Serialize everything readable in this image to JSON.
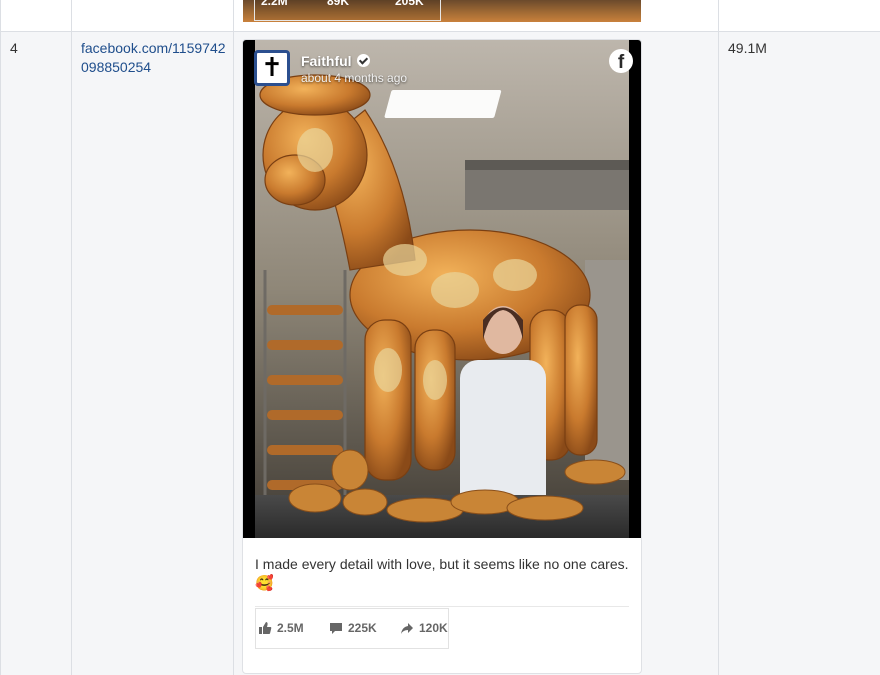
{
  "previous_row": {
    "stats": {
      "likes": "2.2M",
      "comments": "89K",
      "shares": "205K"
    }
  },
  "row": {
    "rank": "4",
    "url": "facebook.com/1159742098850254",
    "views": "49.1M",
    "post": {
      "page_name": "Faithful",
      "avatar_glyph": "✝",
      "time": "about 4 months ago",
      "brand_icon": "facebook-icon",
      "caption": "I made every detail with love, but it seems like no one cares.",
      "caption_emoji": "🥰",
      "stats": {
        "likes": "2.5M",
        "comments": "225K",
        "shares": "120K"
      }
    }
  },
  "colors": {
    "link": "#1f4e8c",
    "row_bg": "#f5f6f8",
    "avatar_border": "#2b4f8f"
  }
}
